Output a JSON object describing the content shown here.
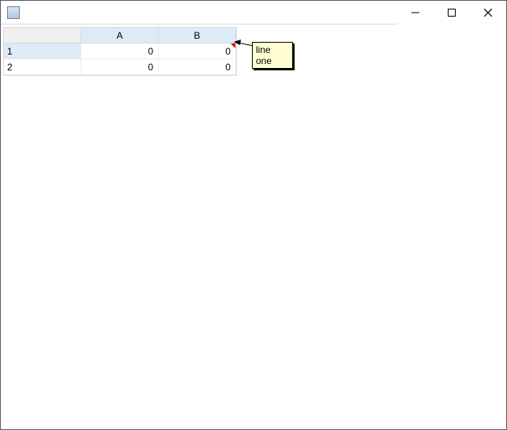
{
  "window": {
    "title": "",
    "controls": {
      "minimize": "min",
      "maximize": "max",
      "close": "close"
    }
  },
  "grid": {
    "columns": [
      "A",
      "B"
    ],
    "rows": [
      {
        "header": "1",
        "selected": true,
        "cells": [
          "0",
          "0"
        ],
        "note_on_col": 1
      },
      {
        "header": "2",
        "selected": false,
        "cells": [
          "0",
          "0"
        ]
      }
    ]
  },
  "note": {
    "text": "line one"
  }
}
